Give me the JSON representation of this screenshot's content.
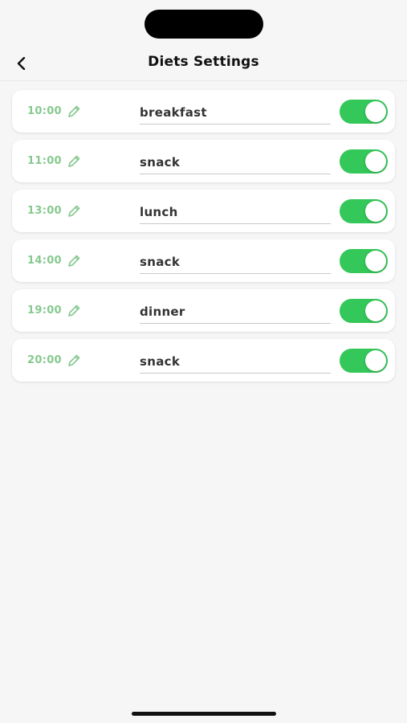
{
  "header": {
    "title": "Diets Settings",
    "back_icon": "chevron-left-icon"
  },
  "meals": [
    {
      "time": "10:00",
      "name": "breakfast",
      "enabled": true
    },
    {
      "time": "11:00",
      "name": "snack",
      "enabled": true
    },
    {
      "time": "13:00",
      "name": "lunch",
      "enabled": true
    },
    {
      "time": "14:00",
      "name": "snack",
      "enabled": true
    },
    {
      "time": "19:00",
      "name": "dinner",
      "enabled": true
    },
    {
      "time": "20:00",
      "name": "snack",
      "enabled": true
    }
  ],
  "colors": {
    "accent": "#34c759",
    "time_text": "#86c98f",
    "background": "#f6f6f6"
  },
  "icons": {
    "edit": "pencil-icon",
    "toggle": "toggle-switch"
  }
}
